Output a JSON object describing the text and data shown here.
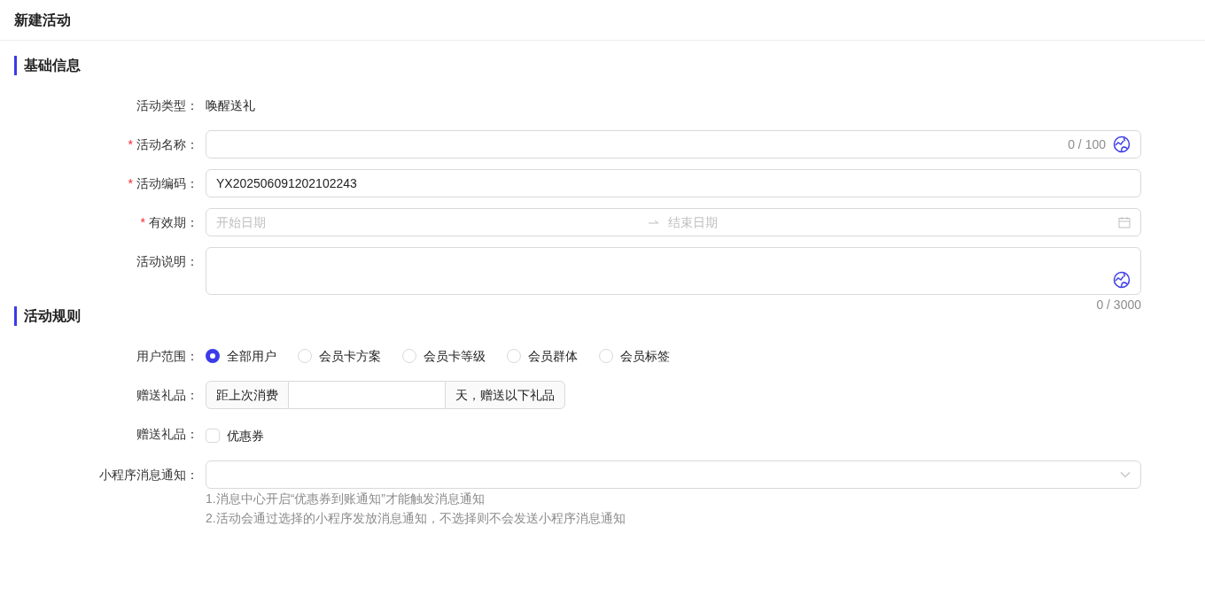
{
  "page": {
    "title": "新建活动"
  },
  "sections": [
    {
      "title": "基础信息",
      "fields": [
        {
          "kind": "text",
          "label": "活动类型：",
          "value": "唤醒送礼"
        },
        {
          "kind": "input",
          "label": "活动名称：",
          "required_mark": "*",
          "counter": "0 / 100",
          "ai_icon": true
        },
        {
          "kind": "input",
          "label": "活动编码：",
          "required_mark": "*",
          "value": "YX202506091202102243"
        },
        {
          "kind": "range",
          "label": "有效期：",
          "required_mark": "*",
          "start_placeholder": "开始日期",
          "end_placeholder": "结束日期"
        },
        {
          "kind": "textarea",
          "label": "活动说明：",
          "counter": "0 / 3000",
          "ai_icon": true
        }
      ]
    },
    {
      "title": "活动规则",
      "fields": [
        {
          "kind": "radio",
          "label": "用户范围：",
          "options": [
            {
              "label": "全部用户",
              "selected": true
            },
            {
              "label": "会员卡方案",
              "selected": false
            },
            {
              "label": "会员卡等级",
              "selected": false
            },
            {
              "label": "会员群体",
              "selected": false
            },
            {
              "label": "会员标签",
              "selected": false
            }
          ]
        },
        {
          "kind": "addon",
          "label": "赠送礼品：",
          "before": "距上次消费",
          "after": "天，赠送以下礼品"
        },
        {
          "kind": "checkbox",
          "label": "赠送礼品：",
          "options": [
            {
              "label": "优惠券",
              "checked": false
            }
          ]
        },
        {
          "kind": "select",
          "label": "小程序消息通知：",
          "hints": [
            "1.消息中心开启“优惠券到账通知”才能触发消息通知",
            "2.活动会通过选择的小程序发放消息通知，不选择则不会发送小程序消息通知"
          ]
        }
      ]
    }
  ]
}
